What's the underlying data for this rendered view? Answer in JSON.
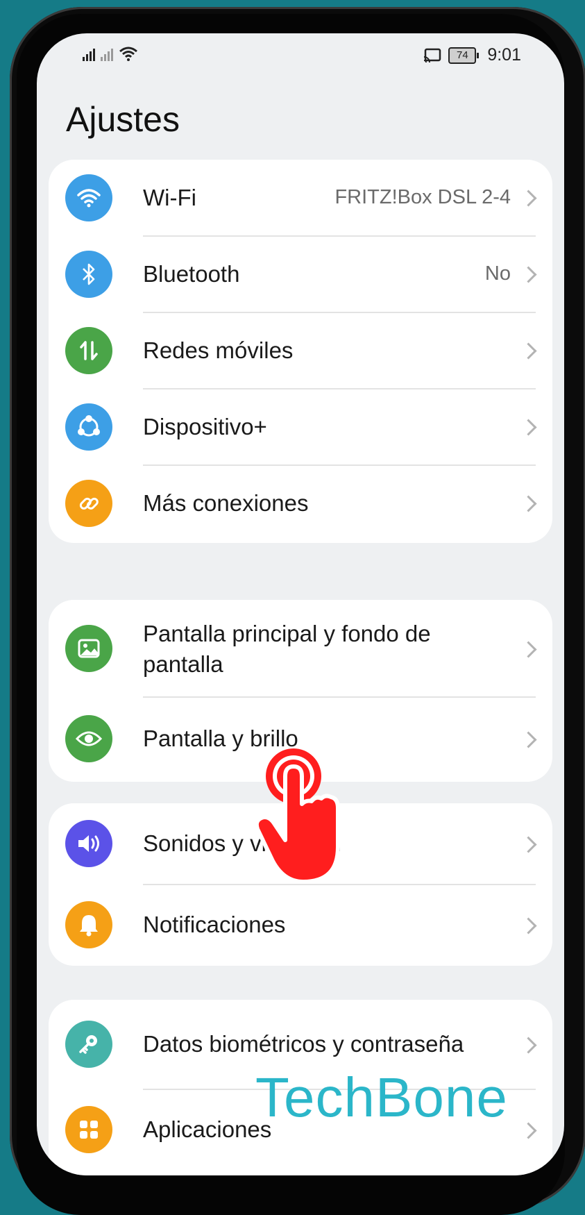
{
  "status_bar": {
    "time": "9:01",
    "battery": "74"
  },
  "page_title": "Ajustes",
  "groups": [
    {
      "items": [
        {
          "label": "Wi-Fi",
          "value": "FRITZ!Box DSL 2-4",
          "icon": "wifi-icon",
          "color": "#3d9fe6"
        },
        {
          "label": "Bluetooth",
          "value": "No",
          "icon": "bluetooth-icon",
          "color": "#3d9fe6"
        },
        {
          "label": "Redes móviles",
          "value": "",
          "icon": "mobile-data-icon",
          "color": "#4aa548"
        },
        {
          "label": "Dispositivo+",
          "value": "",
          "icon": "device-plus-icon",
          "color": "#3d9fe6"
        },
        {
          "label": "Más conexiones",
          "value": "",
          "icon": "link-icon",
          "color": "#f5a016"
        }
      ]
    },
    {
      "items": [
        {
          "label": "Pantalla principal y fondo de pantalla",
          "value": "",
          "icon": "wallpaper-icon",
          "color": "#4aa548"
        },
        {
          "label": "Pantalla y brillo",
          "value": "",
          "icon": "eye-icon",
          "color": "#4aa548"
        }
      ]
    },
    {
      "items": [
        {
          "label": "Sonidos y vibración",
          "value": "",
          "icon": "speaker-icon",
          "color": "#5b52e8"
        },
        {
          "label": "Notificaciones",
          "value": "",
          "icon": "bell-icon",
          "color": "#f5a016"
        }
      ]
    },
    {
      "items": [
        {
          "label": "Datos biométricos y contraseña",
          "value": "",
          "icon": "key-icon",
          "color": "#46b3a9"
        },
        {
          "label": "Aplicaciones",
          "value": "",
          "icon": "apps-icon",
          "color": "#f5a016"
        }
      ]
    }
  ],
  "watermark": "TechBone"
}
